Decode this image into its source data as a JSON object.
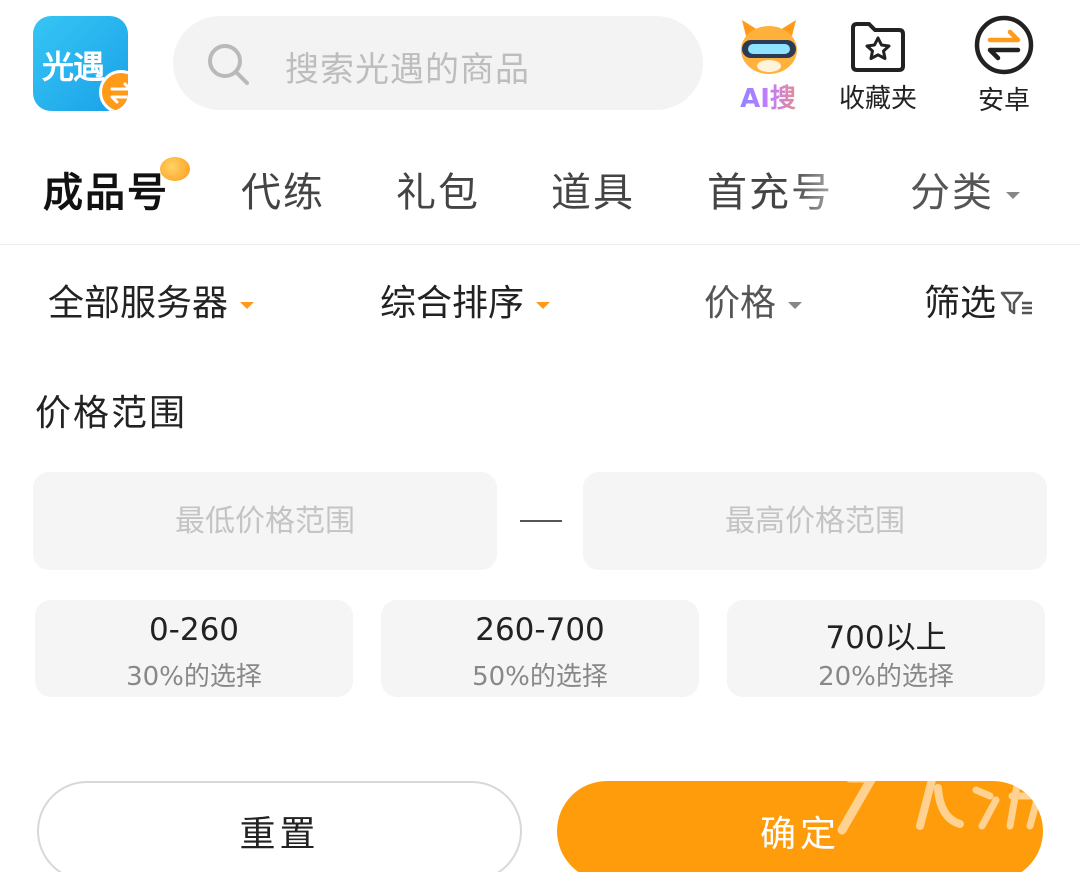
{
  "header": {
    "logo": {
      "text": "光遇",
      "badge_icon": "swap-icon"
    },
    "search": {
      "placeholder": "搜索光遇的商品",
      "icon": "search-icon"
    },
    "actions": [
      {
        "label": "AI搜",
        "icon": "ai-mascot-icon"
      },
      {
        "label": "收藏夹",
        "icon": "star-folder-icon"
      },
      {
        "label": "安卓",
        "icon": "swap-circle-icon"
      }
    ]
  },
  "tabs": [
    {
      "label": "成品号",
      "active": true
    },
    {
      "label": "代练"
    },
    {
      "label": "礼包"
    },
    {
      "label": "道具"
    },
    {
      "label": "首充号"
    },
    {
      "label": "分类"
    }
  ],
  "filters": [
    {
      "label": "全部服务器",
      "icon": "caret-down-icon",
      "accent": "#ff9a1a"
    },
    {
      "label": "综合排序",
      "icon": "caret-down-icon",
      "accent": "#ff9a1a"
    },
    {
      "label": "价格",
      "icon": "caret-down-icon"
    },
    {
      "label": "筛选",
      "icon": "filter-icon"
    }
  ],
  "price_panel": {
    "title": "价格范围",
    "min_placeholder": "最低价格范围",
    "max_placeholder": "最高价格范围",
    "ranges": [
      {
        "range": "0-260",
        "share": "30%的选择"
      },
      {
        "range": "260-700",
        "share": "50%的选择"
      },
      {
        "range": "700以上",
        "share": "20%的选择"
      }
    ]
  },
  "buttons": {
    "reset": "重置",
    "confirm": "确定"
  },
  "colors": {
    "accent": "#ff9c0b",
    "logo_blue": "#1aa0e8"
  }
}
